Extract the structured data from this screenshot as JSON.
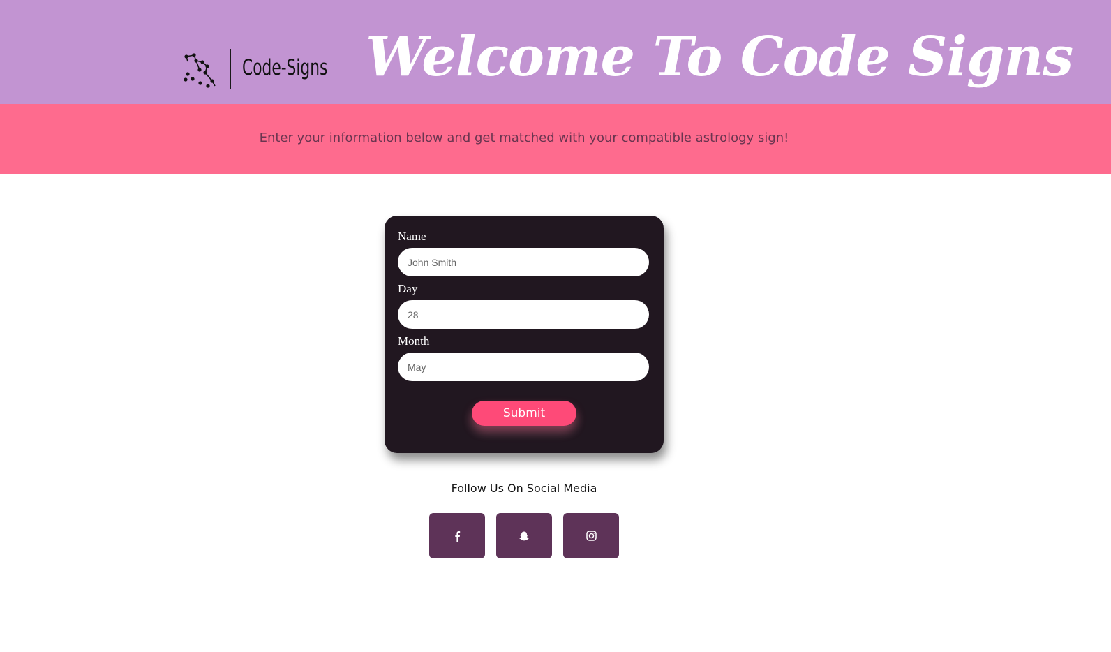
{
  "header": {
    "logo_text": "Code-Signs",
    "welcome_title": "Welcome To Code Signs",
    "background_color": "#c294d2"
  },
  "banner": {
    "text": "Enter your information below and get matched with your compatible astrology sign!",
    "background_color": "#fe6b8e"
  },
  "form": {
    "name_label": "Name",
    "name_placeholder": "John Smith",
    "day_label": "Day",
    "day_placeholder": "28",
    "month_label": "Month",
    "month_placeholder": "May",
    "submit_label": "Submit",
    "background_color": "#211720",
    "submit_color": "#fe4a78"
  },
  "social": {
    "heading": "Follow Us On Social Media",
    "button_color": "#5e3358",
    "links": [
      {
        "icon": "facebook-icon"
      },
      {
        "icon": "snapchat-icon"
      },
      {
        "icon": "instagram-icon"
      }
    ]
  }
}
